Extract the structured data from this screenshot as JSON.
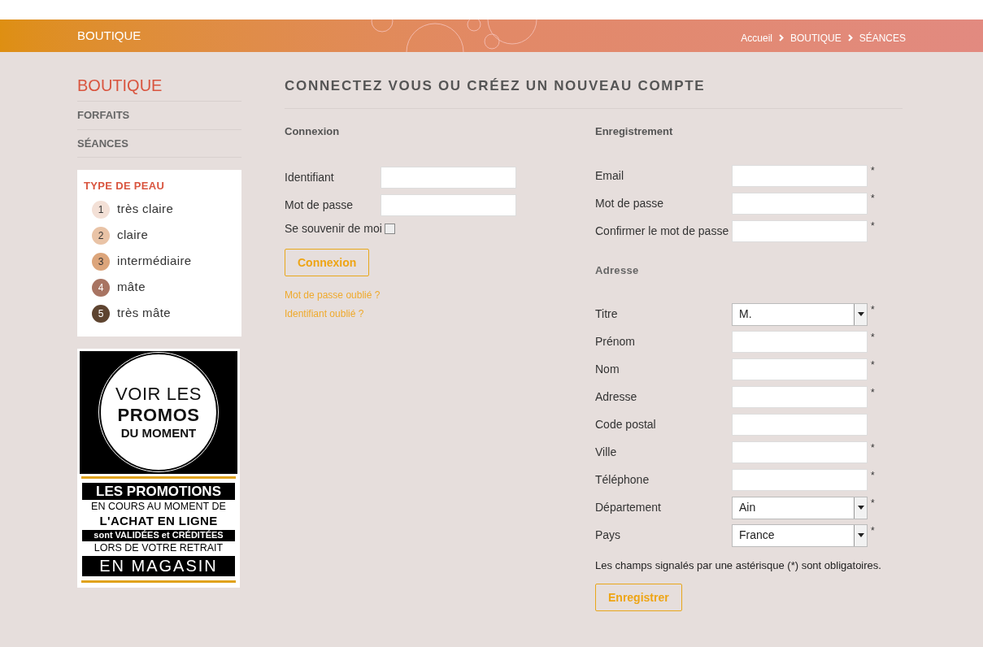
{
  "band": {
    "title": "BOUTIQUE",
    "breadcrumb": [
      "Accueil",
      "BOUTIQUE",
      "SÉANCES"
    ]
  },
  "sidebar": {
    "title": "BOUTIQUE",
    "items": [
      {
        "label": "FORFAITS"
      },
      {
        "label": "SÉANCES"
      }
    ],
    "skin": {
      "title": "TYPE DE PEAU",
      "items": [
        {
          "number": "1",
          "label": "très claire",
          "color": "#f3e0d6"
        },
        {
          "number": "2",
          "label": "claire",
          "color": "#e9c3a6"
        },
        {
          "number": "3",
          "label": "intermédiaire",
          "color": "#dca57b"
        },
        {
          "number": "4",
          "label": "mâte",
          "color": "#a87462"
        },
        {
          "number": "5",
          "label": "très mâte",
          "color": "#5e4430"
        }
      ]
    },
    "promo": {
      "circle": [
        "VOIR LES",
        "PROMOS",
        "DU MOMENT"
      ],
      "lines": [
        "LES PROMOTIONS",
        "EN COURS AU MOMENT DE",
        "L'ACHAT EN LIGNE",
        "sont VALIDÉES et CRÉDITÉES",
        "LORS DE VOTRE RETRAIT",
        "EN MAGASIN"
      ]
    }
  },
  "page_title": "CONNECTEZ VOUS OU CRÉEZ UN NOUVEAU COMPTE",
  "login": {
    "title": "Connexion",
    "fields": [
      {
        "label": "Identifiant"
      },
      {
        "label": "Mot de passe"
      }
    ],
    "remember": {
      "label": "Se souvenir de moi",
      "checked": false
    },
    "button": "Connexion",
    "links": [
      "Mot de passe oublié ?",
      "Identifiant oublié ?"
    ]
  },
  "register": {
    "title": "Enregistrement",
    "fields": [
      {
        "label": "Email",
        "kind": "text",
        "required": true
      },
      {
        "label": "Mot de passe",
        "kind": "text",
        "required": true
      },
      {
        "label": "Confirmer le mot de passe",
        "kind": "text",
        "required": true
      }
    ],
    "address_title": "Adresse",
    "address_fields": [
      {
        "label": "Titre",
        "kind": "select",
        "value": "M.",
        "required": true
      },
      {
        "label": "Prénom",
        "kind": "text",
        "required": true
      },
      {
        "label": "Nom",
        "kind": "text",
        "required": true
      },
      {
        "label": "Adresse",
        "kind": "text",
        "required": true
      },
      {
        "label": "Code postal",
        "kind": "text",
        "required": false
      },
      {
        "label": "Ville",
        "kind": "text",
        "required": true
      },
      {
        "label": "Téléphone",
        "kind": "text",
        "required": true
      },
      {
        "label": "Département",
        "kind": "select",
        "value": "Ain",
        "required": true
      },
      {
        "label": "Pays",
        "kind": "select",
        "value": "France",
        "required": true
      }
    ],
    "required_mark": "*",
    "note": "Les champs signalés par une astérisque (*) sont obligatoires.",
    "button": "Enregistrer"
  }
}
